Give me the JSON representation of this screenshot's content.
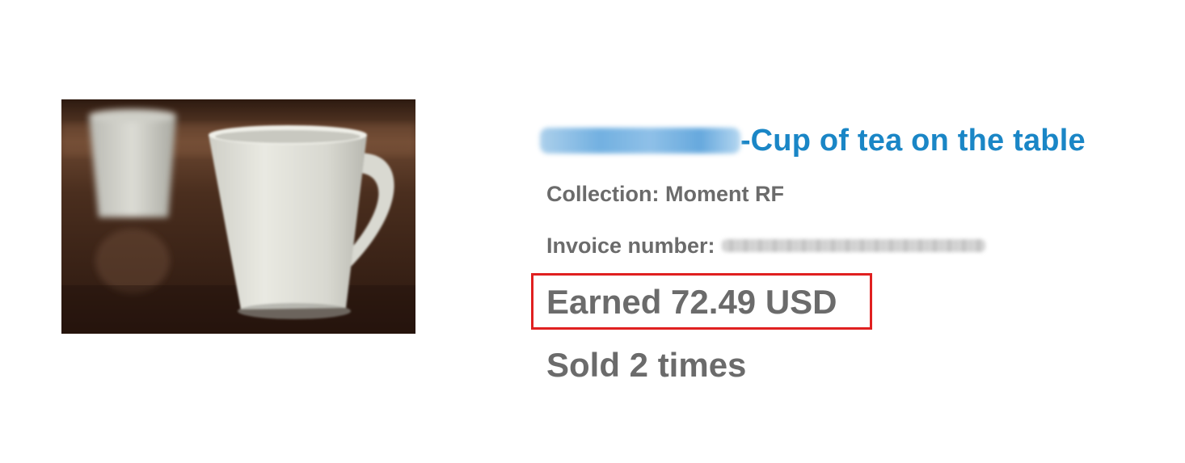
{
  "item": {
    "thumbnail_icon": "mug-photo",
    "title_prefix_dash": "-",
    "title": "Cup of tea on the table",
    "collection": "Collection: Moment RF",
    "invoice_label": "Invoice number:",
    "earned": "Earned 72.49 USD",
    "sold": "Sold 2 times"
  },
  "colors": {
    "title_link": "#1a86c6",
    "meta_text": "#6b6b6b",
    "highlight_border": "#e02020"
  }
}
